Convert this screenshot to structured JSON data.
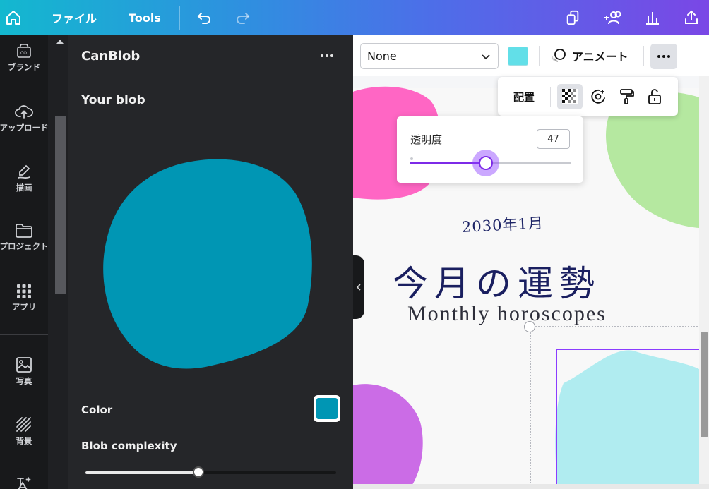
{
  "topbar": {
    "file_label": "ファイル",
    "tools_label": "Tools"
  },
  "sidebar": {
    "items": [
      {
        "label": "ブランド",
        "icon": "brand-icon"
      },
      {
        "label": "アップロード",
        "icon": "upload-icon"
      },
      {
        "label": "描画",
        "icon": "draw-icon"
      },
      {
        "label": "プロジェクト",
        "icon": "folder-icon"
      },
      {
        "label": "アプリ",
        "icon": "apps-grid-icon"
      },
      {
        "label": "写真",
        "icon": "photo-icon"
      },
      {
        "label": "背景",
        "icon": "background-icon"
      }
    ]
  },
  "panel": {
    "title": "CanBlob",
    "your_blob": "Your blob",
    "color_label": "Color",
    "blob_color": "#0096b4",
    "complexity_label": "Blob complexity",
    "complexity_value": 0.45
  },
  "toolbar": {
    "font_value": "None",
    "element_color": "#62dfe8",
    "animate_label": "アニメート"
  },
  "arrange_menu": {
    "label": "配置"
  },
  "transparency": {
    "label": "透明度",
    "value": "47",
    "level": 0.47
  },
  "canvas": {
    "date": "2030年1月",
    "title": "今月の運勢",
    "subtitle": "Monthly horoscopes",
    "colors": {
      "pink": "#ff66c4",
      "green": "#b5e8a0",
      "purple": "#cb6ce6",
      "cyan": "#b0ecf0",
      "accent": "#8b3dff"
    }
  }
}
